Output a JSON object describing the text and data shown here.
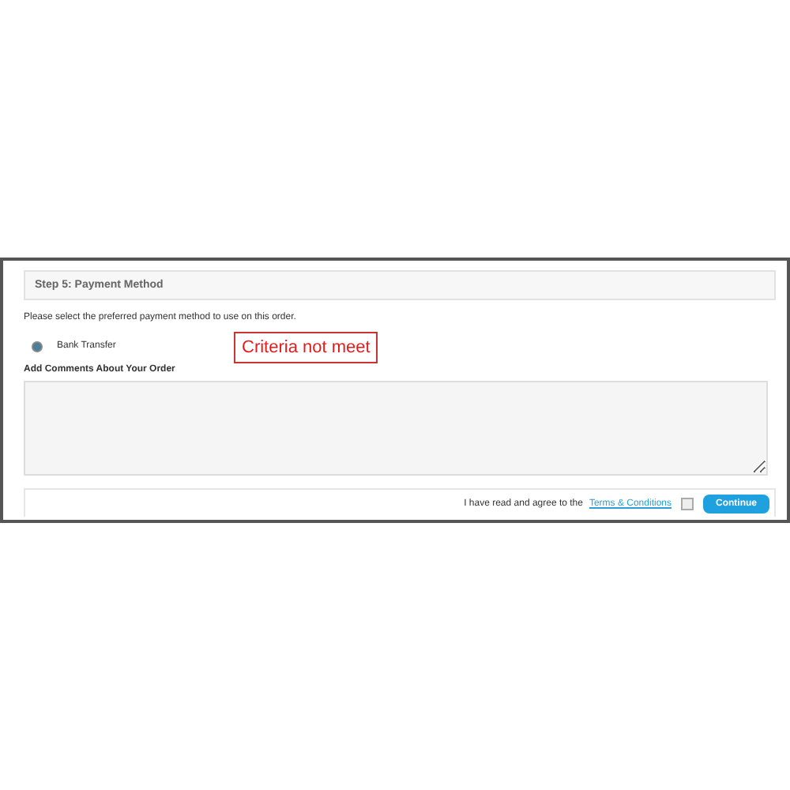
{
  "step_heading": "Step 5: Payment Method",
  "intro": "Please select the preferred payment method to use on this order.",
  "payment_methods": [
    {
      "label": "Bank Transfer",
      "selected": true
    }
  ],
  "warning": "Criteria not meet",
  "comments": {
    "label": "Add Comments About Your Order"
  },
  "agreement": {
    "text": "I have read and agree to the",
    "link": "Terms & Conditions",
    "checked": false
  },
  "continue_button": "Continue"
}
